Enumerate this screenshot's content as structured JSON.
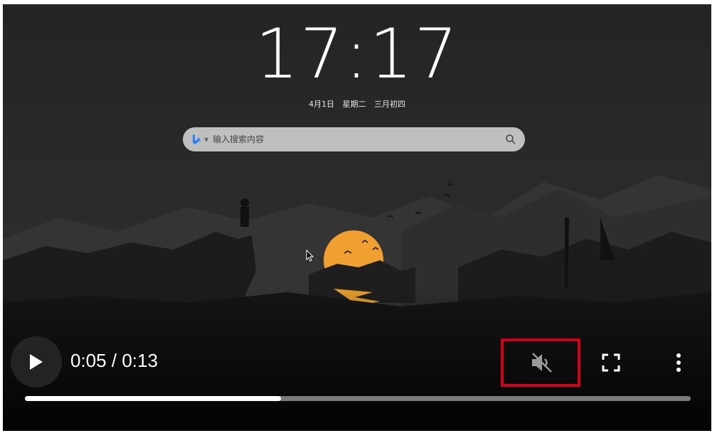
{
  "clock": {
    "time": "17:17"
  },
  "date": {
    "day": "4月1日",
    "weekday": "星期二",
    "lunar": "三月初四"
  },
  "search": {
    "placeholder": "输入搜索内容",
    "engine_icon": "bing-icon",
    "search_icon": "magnifier-icon"
  },
  "player": {
    "current_time": "0:05",
    "separator": "/",
    "duration": "0:13",
    "progress_fraction": 0.385,
    "muted": true,
    "icons": {
      "play": "play-icon",
      "mute": "volume-muted-icon",
      "fullscreen": "fullscreen-icon",
      "more": "more-vertical-icon"
    }
  },
  "colors": {
    "accent": "#d0021b",
    "sun": "#f0a030",
    "search_bg": "#bfbfbf",
    "bing_blue": "#2a7fff"
  }
}
